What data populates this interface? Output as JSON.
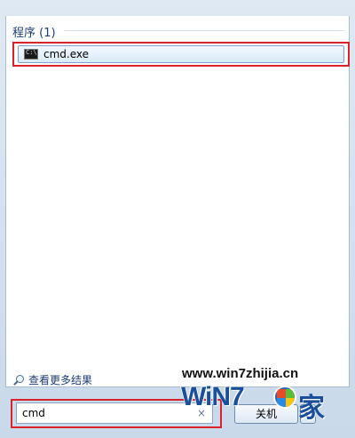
{
  "results_pane": {
    "group_header": "程序 (1)",
    "items": [
      {
        "label": "cmd.exe",
        "icon": "cmd-icon"
      }
    ]
  },
  "more_results": {
    "icon": "magnifier-icon",
    "label": "查看更多结果"
  },
  "search": {
    "value": "cmd",
    "clear_glyph": "×"
  },
  "power": {
    "label": "关机",
    "arrow_glyph": "▶"
  },
  "watermark": {
    "url": "www.win7zhijia.cn",
    "logo_text": "WiN7",
    "logo_char": "家"
  },
  "colors": {
    "highlight": "#d8232a",
    "header_text": "#1e3d73",
    "selection_border": "#7da2ce"
  }
}
